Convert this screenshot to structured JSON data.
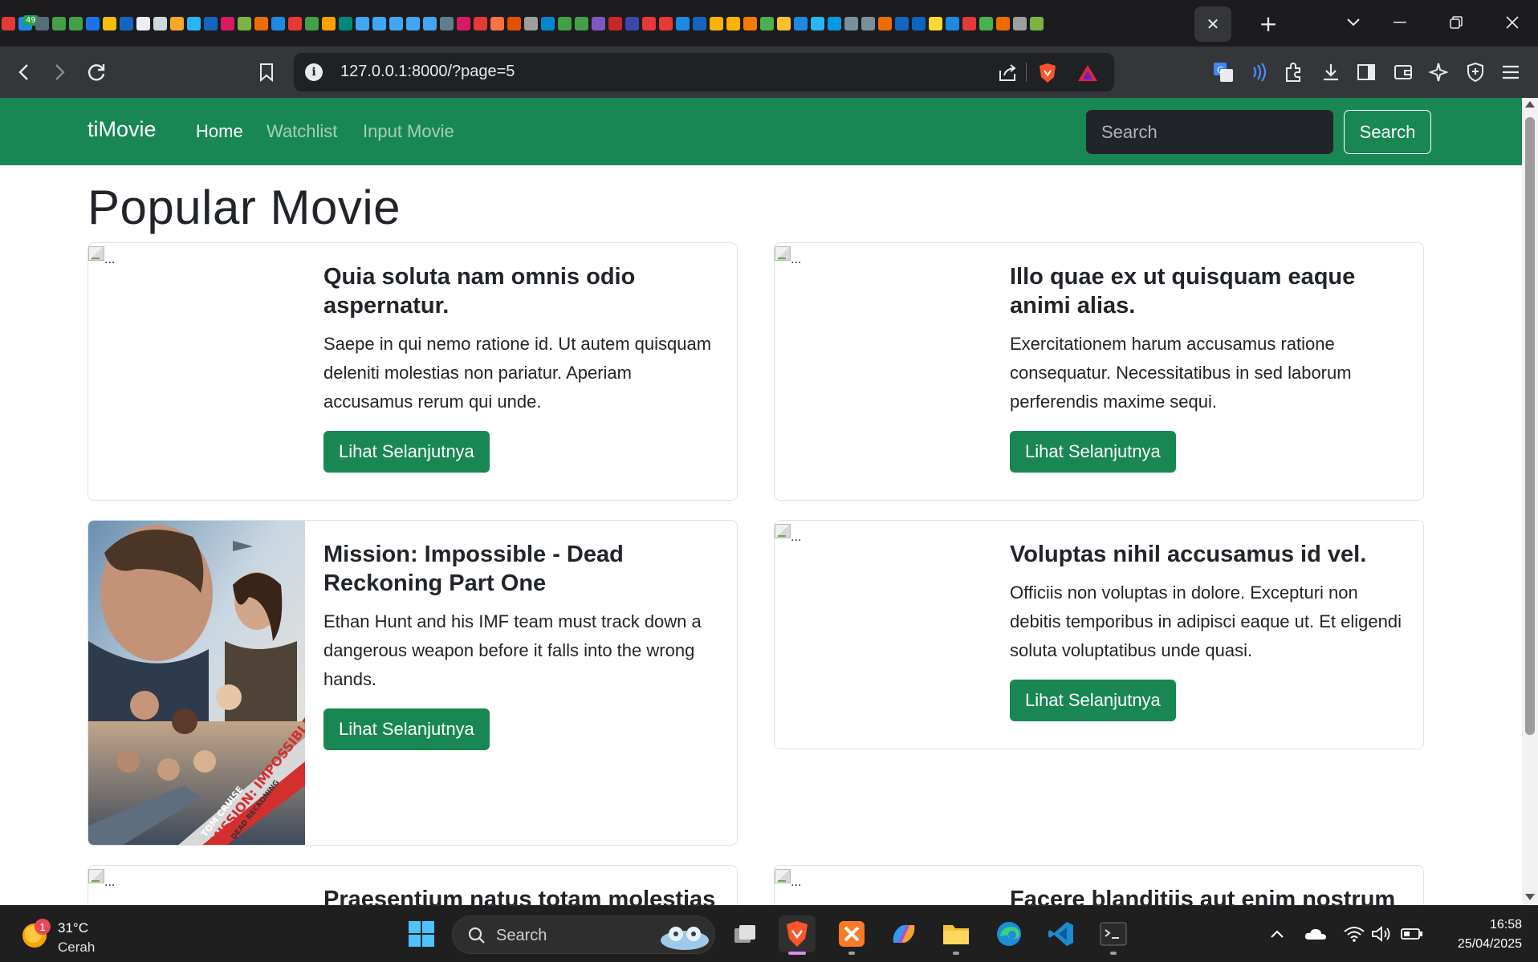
{
  "browser": {
    "tab_badge": "49",
    "tab_close_label": "✕",
    "new_tab_label": "+",
    "url": "127.0.0.1:8000/?page=5",
    "window_controls": {
      "minimize": "—",
      "restore": "❐",
      "close": "✕"
    },
    "favicon_colors": [
      "#e53935",
      "#1e88e5",
      "#546e7a",
      "#43a047",
      "#43a047",
      "#1a73e8",
      "#fbbc04",
      "#1565c0",
      "#eceff1",
      "#cfd8dc",
      "#f9a825",
      "#29b6f6",
      "#1565c0",
      "#d81b60",
      "#7cb342",
      "#ef6c00",
      "#1e88e5",
      "#e53935",
      "#43a047",
      "#ffa000",
      "#00897b",
      "#42a5f5",
      "#42a5f5",
      "#42a5f5",
      "#42a5f5",
      "#42a5f5",
      "#607d8b",
      "#d81b60",
      "#e53935",
      "#ff7043",
      "#e65100",
      "#9e9e9e",
      "#0288d1",
      "#43a047",
      "#43a047",
      "#7e57c2",
      "#c62828",
      "#3949ab",
      "#e53935",
      "#e53935",
      "#1e88e5",
      "#1565c0",
      "#ffb300",
      "#ffb300",
      "#f57c00",
      "#4caf50",
      "#fbc02d",
      "#1e88e5",
      "#29b6f6",
      "#039be5",
      "#78909c",
      "#78909c",
      "#ef6c00",
      "#1565c0",
      "#0a66c2",
      "#fdd835",
      "#1e88e5",
      "#e53935",
      "#4caf50",
      "#ef6c00",
      "#9e9e9e",
      "#7cb342"
    ]
  },
  "site": {
    "brand": "tiMovie",
    "nav": [
      {
        "label": "Home",
        "active": true
      },
      {
        "label": "Watchlist",
        "active": false
      },
      {
        "label": "Input Movie",
        "active": false
      }
    ],
    "search": {
      "placeholder": "Search",
      "button_label": "Search"
    },
    "page_title": "Popular Movie",
    "broken_image_alt": "...",
    "movies": [
      {
        "title": "Quia soluta nam omnis odio aspernatur.",
        "description": "Saepe in qui nemo ratione id. Ut autem quisquam deleniti molestias non pariatur. Aperiam accusamus rerum qui unde.",
        "button": "Lihat Selanjutnya",
        "has_poster": false
      },
      {
        "title": "Illo quae ex ut quisquam eaque animi alias.",
        "description": "Exercitationem harum accusamus ratione consequatur. Necessitatibus in sed laborum perferendis maxime sequi.",
        "button": "Lihat Selanjutnya",
        "has_poster": false
      },
      {
        "title": "Mission: Impossible - Dead Reckoning Part One",
        "description": "Ethan Hunt and his IMF team must track down a dangerous weapon before it falls into the wrong hands.",
        "button": "Lihat Selanjutnya",
        "has_poster": true,
        "poster_text": {
          "actor": "TOM CRUISE",
          "title": "MISSION: IMPOSSIBLE",
          "subtitle": "DEAD RECKONING"
        }
      },
      {
        "title": "Voluptas nihil accusamus id vel.",
        "description": "Officiis non voluptas in dolore. Excepturi non debitis temporibus in adipisci eaque ut. Et eligendi soluta voluptatibus unde quasi.",
        "button": "Lihat Selanjutnya",
        "has_poster": false
      },
      {
        "title": "Praesentium natus totam molestias",
        "description": "",
        "button": "",
        "has_poster": false
      },
      {
        "title": "Facere blanditiis aut enim nostrum",
        "description": "",
        "button": "",
        "has_poster": false
      }
    ],
    "colors": {
      "primary": "#198754",
      "dark": "#212529"
    }
  },
  "taskbar": {
    "weather": {
      "temp": "31°C",
      "desc": "Cerah",
      "badge": "1"
    },
    "search_label": "Search",
    "clock": {
      "time": "16:58",
      "date": "25/04/2025"
    },
    "apps": [
      "windows-start",
      "task-view",
      "brave-browser",
      "xampp",
      "copilot",
      "file-explorer",
      "edge",
      "vscode",
      "terminal"
    ]
  }
}
